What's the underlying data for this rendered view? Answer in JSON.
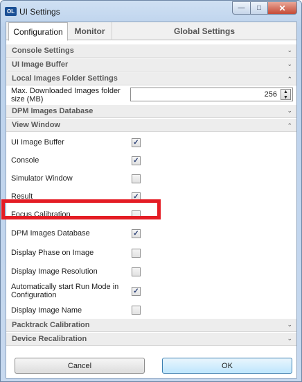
{
  "window": {
    "icon_text": "OL",
    "title": "UI Settings",
    "minimize_glyph": "—",
    "maximize_glyph": "□",
    "close_glyph": "✕"
  },
  "tabs": [
    {
      "label": "Configuration",
      "active": true
    },
    {
      "label": "Monitor",
      "active": false
    },
    {
      "label": "Global Settings",
      "active": false
    }
  ],
  "sections": {
    "console_settings": {
      "label": "Console Settings",
      "expanded": false
    },
    "ui_image_buffer": {
      "label": "UI Image Buffer",
      "expanded": false
    },
    "local_images_folder": {
      "label": "Local Images Folder Settings",
      "expanded": true
    },
    "dpm_images_database": {
      "label": "DPM Images Database",
      "expanded": false
    },
    "view_window": {
      "label": "View Window",
      "expanded": true
    },
    "packtrack_calibration": {
      "label": "Packtrack Calibration",
      "expanded": false
    },
    "device_recalibration": {
      "label": "Device Recalibration",
      "expanded": false
    }
  },
  "local_folder": {
    "max_size_label_line1": "Max. Downloaded Images folder",
    "max_size_label_line2": "size (MB)",
    "max_size_value": "256"
  },
  "view_window_items": [
    {
      "label": "UI Image Buffer",
      "checked": true
    },
    {
      "label": "Console",
      "checked": true
    },
    {
      "label": "Simulator Window",
      "checked": false
    },
    {
      "label": "Result",
      "checked": true
    },
    {
      "label": "Focus Calibration",
      "checked": false
    },
    {
      "label": "DPM Images Database",
      "checked": true
    },
    {
      "label": "Display Phase on Image",
      "checked": false
    },
    {
      "label": "Display Image Resolution",
      "checked": false
    },
    {
      "label": "Automatically start Run Mode in Configuration",
      "checked": true
    },
    {
      "label": "Display Image Name",
      "checked": false
    }
  ],
  "buttons": {
    "cancel": "Cancel",
    "ok": "OK"
  },
  "icons": {
    "chevron_collapsed": "⌄",
    "chevron_expanded": "⌃",
    "check": "✓",
    "spin_up": "▲",
    "spin_down": "▼"
  }
}
